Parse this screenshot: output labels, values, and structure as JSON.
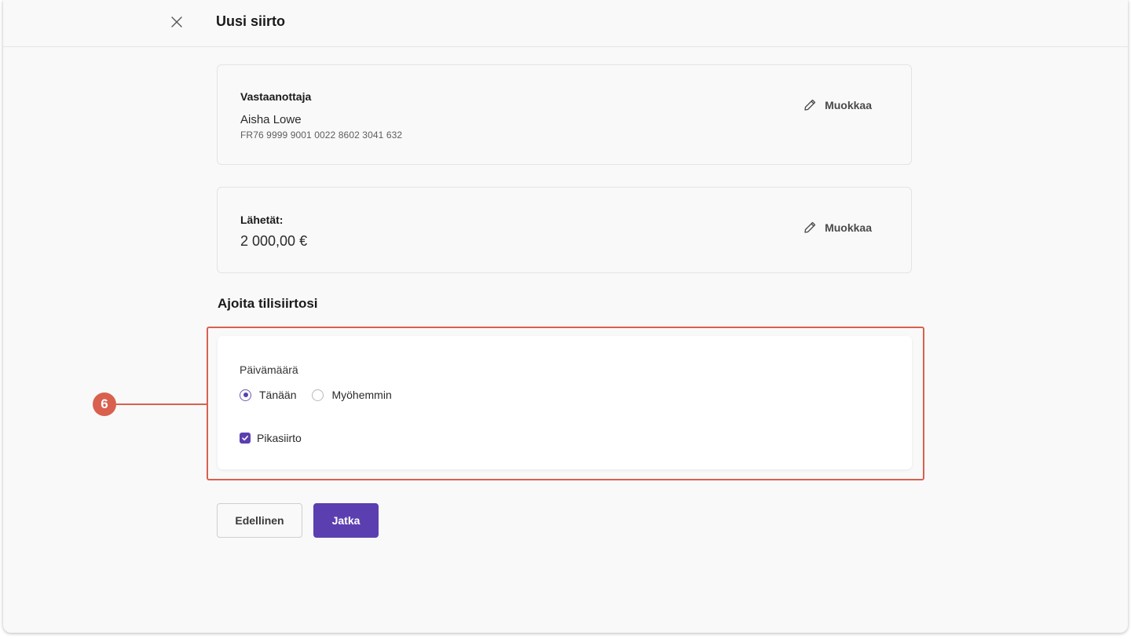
{
  "header": {
    "title": "Uusi siirto",
    "close_icon": "close-icon"
  },
  "recipient": {
    "label": "Vastaanottaja",
    "name": "Aisha Lowe",
    "iban": "FR76 9999 9001 0022 8602 3041 632",
    "edit_label": "Muokkaa",
    "edit_icon": "pencil-icon"
  },
  "amount": {
    "label": "Lähetät:",
    "value": "2 000,00 €",
    "edit_label": "Muokkaa",
    "edit_icon": "pencil-icon"
  },
  "schedule": {
    "title": "Ajoita tilisiirtosi",
    "date_label": "Päivämäärä",
    "options": [
      {
        "label": "Tänään",
        "selected": true
      },
      {
        "label": "Myöhemmin",
        "selected": false
      }
    ],
    "instant": {
      "label": "Pikasiirto",
      "checked": true
    }
  },
  "annotation": {
    "step_number": "6",
    "color": "#d9604f"
  },
  "actions": {
    "previous_label": "Edellinen",
    "continue_label": "Jatka"
  },
  "colors": {
    "accent": "#5b3fb0",
    "annotation": "#d9604f",
    "background": "#f9f9f9"
  }
}
